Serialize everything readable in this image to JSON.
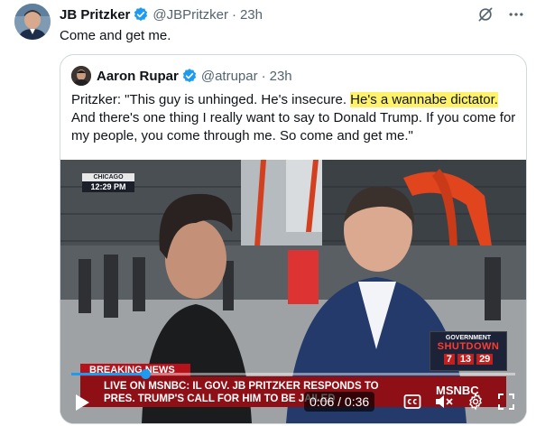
{
  "tweet": {
    "author_name": "JB Pritzker",
    "handle": "@JBPritzker",
    "separator": "·",
    "time": "23h",
    "text": "Come and get me."
  },
  "quote": {
    "author_name": "Aaron Rupar",
    "handle": "@atrupar",
    "separator": "·",
    "time": "23h",
    "text_before": "Pritzker: \"This guy is unhinged. He's insecure. ",
    "text_highlight": "He's a wannabe dictator.",
    "text_after": " And there's one thing I really want to say to Donald Trump. If you come for my people, you come through me. So come and get me.\""
  },
  "video": {
    "location": "CHICAGO",
    "clock": "12:29 PM",
    "badge_top": "GOVERNMENT",
    "badge_mid": "SHUTDOWN",
    "badge_nums": [
      "7",
      "13",
      "29"
    ],
    "breaking": "BREAKING NEWS",
    "ticker_line1": "LIVE ON MSNBC: IL GOV. JB PRITZKER RESPONDS TO",
    "ticker_line2": "PRES. TRUMP'S CALL FOR HIM TO BE JAILED",
    "network": "MSNBC",
    "current_time": "0:06",
    "duration": "0:36",
    "time_sep": " / ",
    "progress": 0.167
  },
  "icons": {
    "verified": "verified-badge-icon",
    "grok": "grok-icon",
    "more": "more-icon",
    "play": "play-icon",
    "captions": "captions-icon",
    "mute": "mute-icon",
    "settings": "settings-icon",
    "fullscreen": "fullscreen-icon"
  },
  "colors": {
    "verified": "#1d9bf0",
    "highlight": "#fff26b",
    "breaking_red": "#b5121b",
    "progress": "#1d9bf0"
  }
}
